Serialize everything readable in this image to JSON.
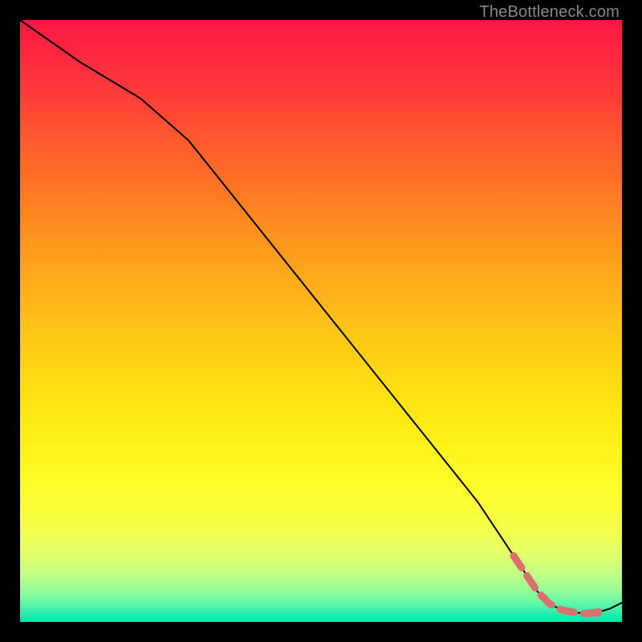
{
  "watermark": "TheBottleneck.com",
  "chart_data": {
    "type": "line",
    "title": "",
    "xlabel": "",
    "ylabel": "",
    "xlim": [
      0,
      100
    ],
    "ylim": [
      0,
      100
    ],
    "grid": false,
    "legend": false,
    "background_gradient": {
      "top": "#ff1744",
      "middle": "#ffe012",
      "bottom": "#00e5a8"
    },
    "series": [
      {
        "name": "main-curve",
        "color": "#000000",
        "stroke_width": 2,
        "x": [
          0,
          10,
          20,
          28,
          36,
          44,
          52,
          60,
          68,
          76,
          82,
          86,
          88,
          90,
          92,
          94,
          96,
          98,
          100
        ],
        "values": [
          100,
          93,
          87,
          80,
          70,
          60,
          50,
          40,
          30,
          20,
          11,
          5,
          3,
          2.0,
          1.6,
          1.4,
          1.6,
          2.2,
          3.2
        ]
      },
      {
        "name": "highlight-segment",
        "color": "#d87070",
        "stroke_width": 9,
        "dash": "18 12",
        "endpoint_marker": true,
        "x": [
          82,
          86,
          88,
          90,
          92,
          94,
          96
        ],
        "values": [
          11,
          5,
          3,
          2.0,
          1.6,
          1.4,
          1.6
        ]
      }
    ]
  }
}
